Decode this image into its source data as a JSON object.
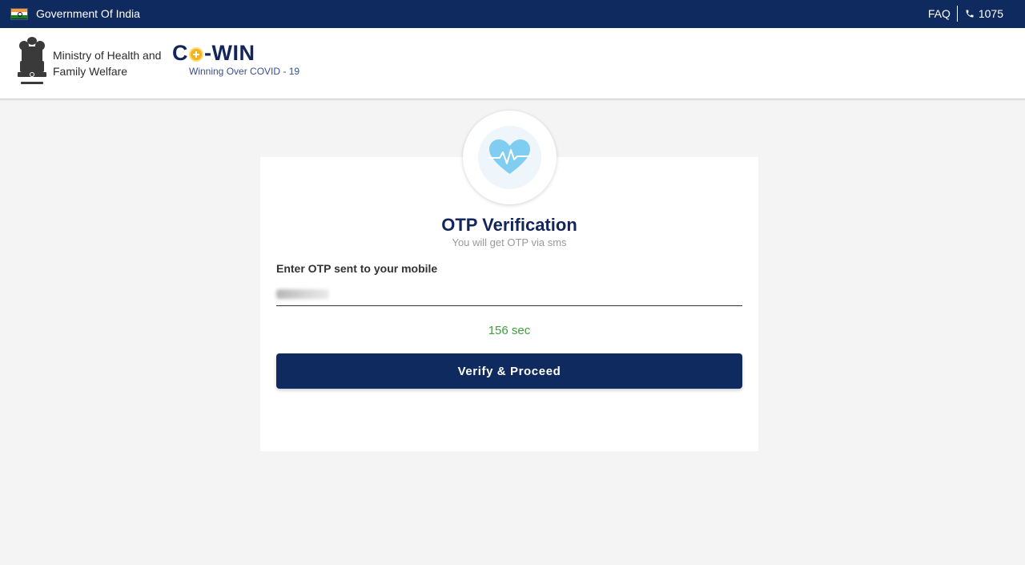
{
  "topbar": {
    "gov_label": "Government Of India",
    "faq_label": "FAQ",
    "helpline": "1075",
    "flag_icon": "india-flag-icon",
    "phone_icon": "phone-icon"
  },
  "header": {
    "ministry_line1": "Ministry of Health and",
    "ministry_line2": "Family Welfare",
    "brand_title_left": "C",
    "brand_title_right": "-WIN",
    "brand_tagline": "Winning Over COVID - 19",
    "emblem_icon": "national-emblem-icon"
  },
  "otp": {
    "badge_icon": "heartbeat-icon",
    "title": "OTP Verification",
    "subtitle": "You will get OTP via sms",
    "field_label": "Enter OTP sent to your mobile",
    "timer": "156 sec",
    "verify_button": "Verify & Proceed"
  },
  "colors": {
    "navy": "#0e2a5f",
    "timer_green": "#3da03d",
    "accent_yellow": "#f2b31e",
    "heart_blue": "#7fcdf0"
  }
}
